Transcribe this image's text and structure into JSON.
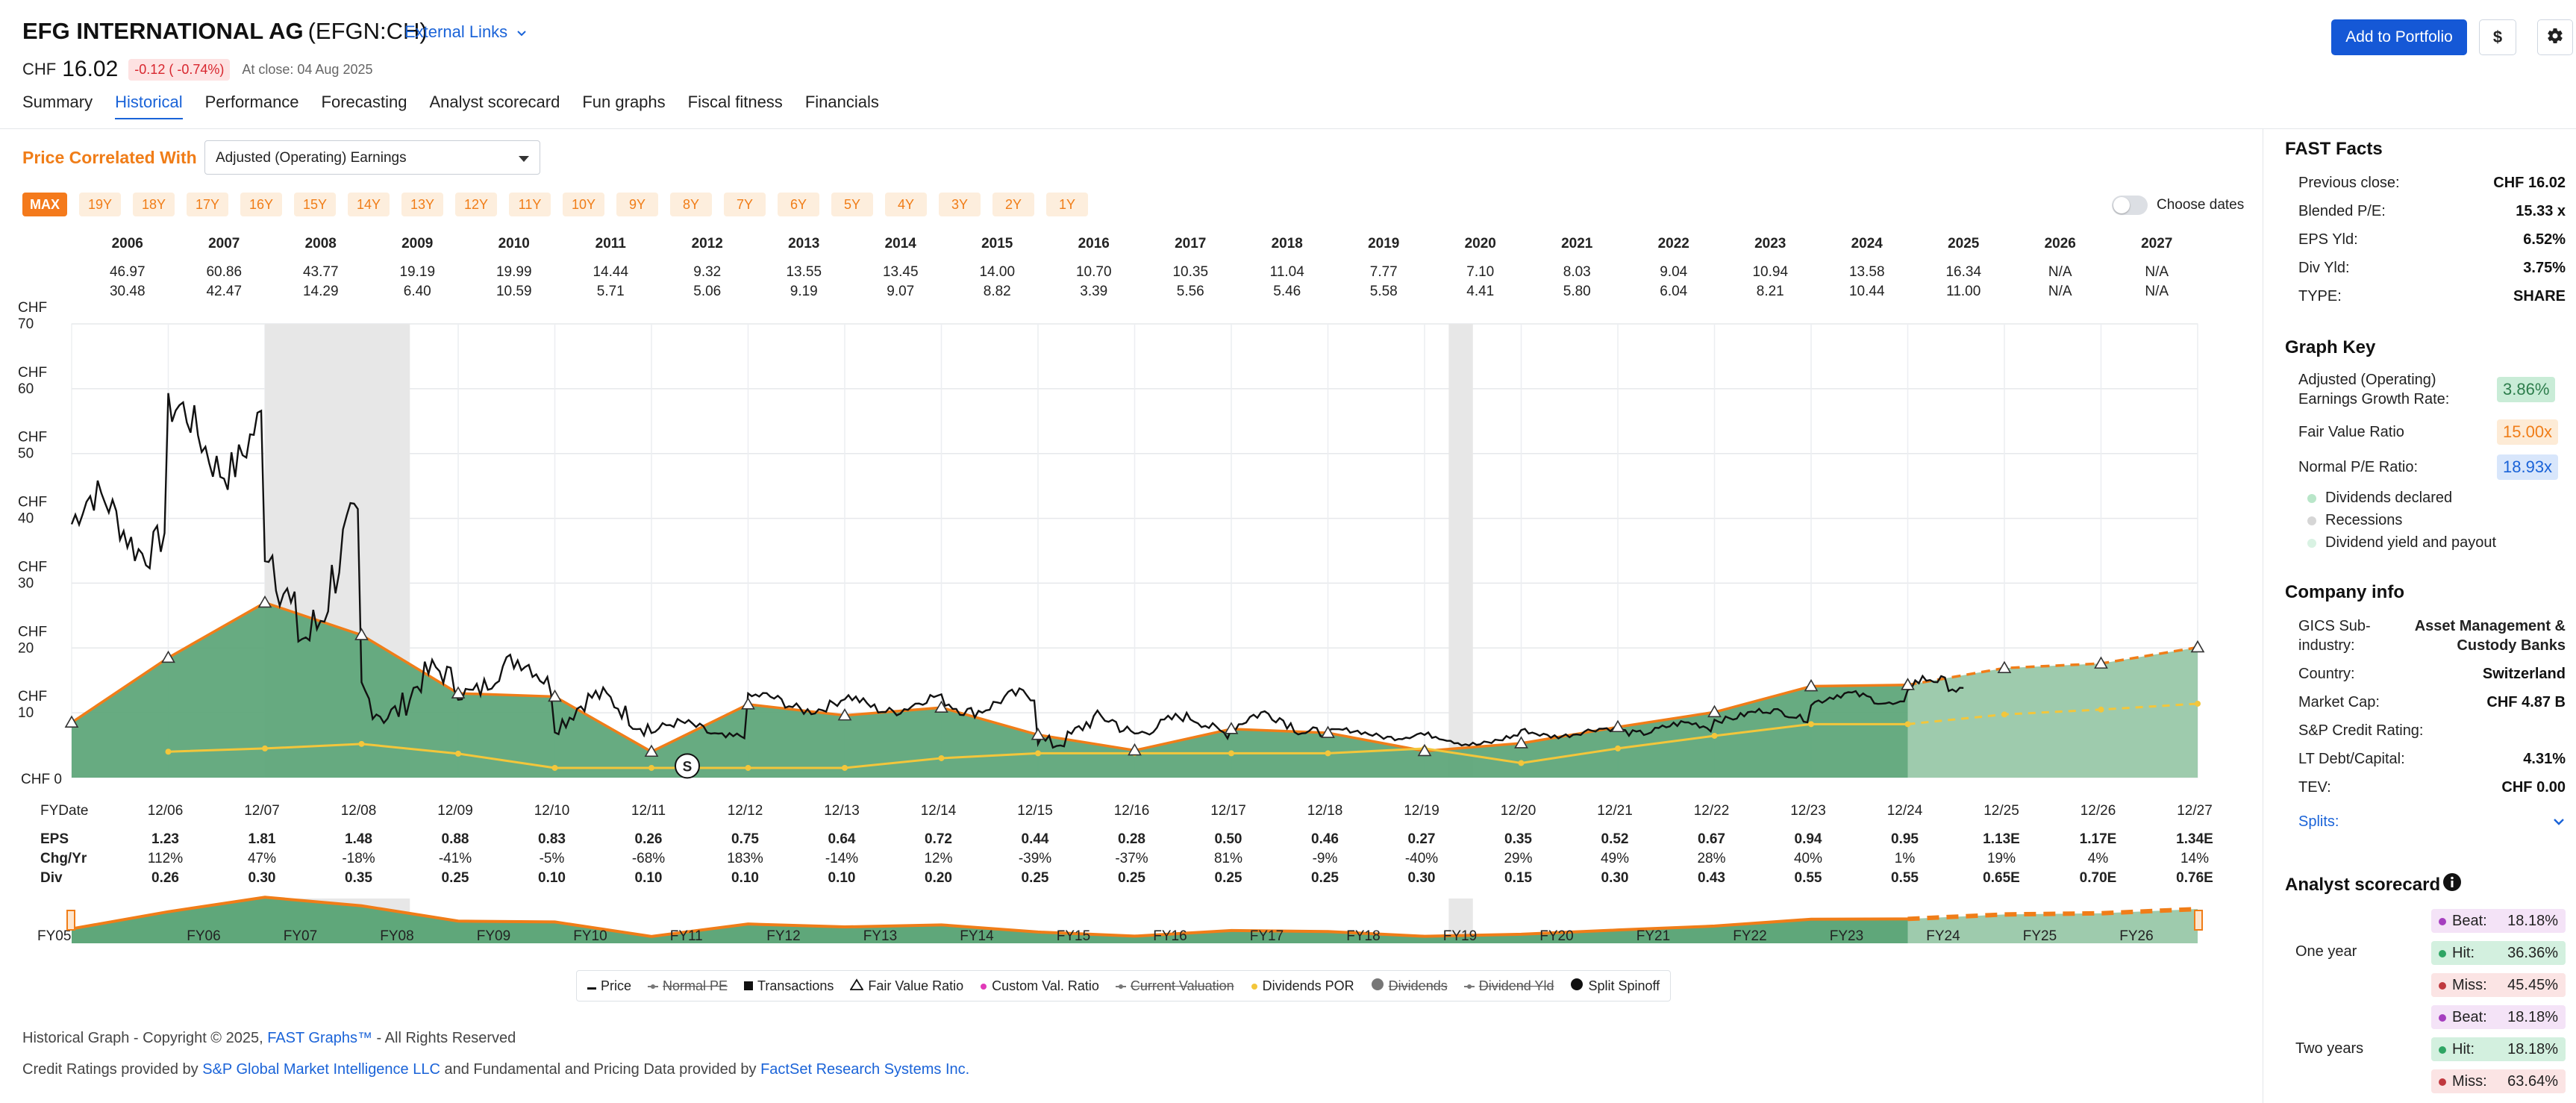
{
  "header": {
    "company": "EFG INTERNATIONAL AG",
    "ticker": "(EFGN:CH)",
    "external_links": "External Links",
    "currency": "CHF",
    "price": "16.02",
    "change": "-0.12 ( -0.74%)",
    "close_note": "At close: 04 Aug 2025",
    "add_portfolio": "Add to Portfolio",
    "currency_button": "$"
  },
  "nav": {
    "tabs": [
      "Summary",
      "Historical",
      "Performance",
      "Forecasting",
      "Analyst scorecard",
      "Fun graphs",
      "Fiscal fitness",
      "Financials"
    ],
    "active": "Historical"
  },
  "correlated": {
    "label": "Price Correlated With",
    "selected": "Adjusted (Operating) Earnings"
  },
  "ranges": [
    "MAX",
    "19Y",
    "18Y",
    "17Y",
    "16Y",
    "15Y",
    "14Y",
    "13Y",
    "12Y",
    "11Y",
    "10Y",
    "9Y",
    "8Y",
    "7Y",
    "6Y",
    "5Y",
    "4Y",
    "3Y",
    "2Y",
    "1Y"
  ],
  "choose_dates": "Choose dates",
  "yearly": {
    "years": [
      "2006",
      "2007",
      "2008",
      "2009",
      "2010",
      "2011",
      "2012",
      "2013",
      "2014",
      "2015",
      "2016",
      "2017",
      "2018",
      "2019",
      "2020",
      "2021",
      "2022",
      "2023",
      "2024",
      "2025",
      "2026",
      "2027"
    ],
    "highs": [
      "46.97",
      "60.86",
      "43.77",
      "19.19",
      "19.99",
      "14.44",
      "9.32",
      "13.55",
      "13.45",
      "14.00",
      "10.70",
      "10.35",
      "11.04",
      "7.77",
      "7.10",
      "8.03",
      "9.04",
      "10.94",
      "13.58",
      "16.34",
      "N/A",
      "N/A"
    ],
    "lows": [
      "30.48",
      "42.47",
      "14.29",
      "6.40",
      "10.59",
      "5.71",
      "5.06",
      "9.19",
      "9.07",
      "8.82",
      "3.39",
      "5.56",
      "5.46",
      "5.58",
      "4.41",
      "5.80",
      "6.04",
      "8.21",
      "10.44",
      "11.00",
      "N/A",
      "N/A"
    ]
  },
  "y_axis": [
    "CHF 70",
    "CHF 60",
    "CHF 50",
    "CHF 40",
    "CHF 30",
    "CHF 20",
    "CHF 10",
    "CHF 0"
  ],
  "fiscal": {
    "label_fydate": "FYDate",
    "label_eps": "EPS",
    "label_chg": "Chg/Yr",
    "label_div": "Div",
    "dates": [
      "12/06",
      "12/07",
      "12/08",
      "12/09",
      "12/10",
      "12/11",
      "12/12",
      "12/13",
      "12/14",
      "12/15",
      "12/16",
      "12/17",
      "12/18",
      "12/19",
      "12/20",
      "12/21",
      "12/22",
      "12/23",
      "12/24",
      "12/25",
      "12/26",
      "12/27"
    ],
    "eps": [
      "1.23",
      "1.81",
      "1.48",
      "0.88",
      "0.83",
      "0.26",
      "0.75",
      "0.64",
      "0.72",
      "0.44",
      "0.28",
      "0.50",
      "0.46",
      "0.27",
      "0.35",
      "0.52",
      "0.67",
      "0.94",
      "0.95",
      "1.13E",
      "1.17E",
      "1.34E"
    ],
    "chg": [
      "112%",
      "47%",
      "-18%",
      "-41%",
      "-5%",
      "-68%",
      "183%",
      "-14%",
      "12%",
      "-39%",
      "-37%",
      "81%",
      "-9%",
      "-40%",
      "29%",
      "49%",
      "28%",
      "40%",
      "1%",
      "19%",
      "4%",
      "14%"
    ],
    "div": [
      "0.26",
      "0.30",
      "0.35",
      "0.25",
      "0.10",
      "0.10",
      "0.10",
      "0.10",
      "0.20",
      "0.25",
      "0.25",
      "0.25",
      "0.25",
      "0.30",
      "0.15",
      "0.30",
      "0.43",
      "0.55",
      "0.55",
      "0.65E",
      "0.70E",
      "0.76E"
    ]
  },
  "mini_labels": [
    "FY05",
    "FY06",
    "FY07",
    "FY08",
    "FY09",
    "FY10",
    "FY11",
    "FY12",
    "FY13",
    "FY14",
    "FY15",
    "FY16",
    "FY17",
    "FY18",
    "FY19",
    "FY20",
    "FY21",
    "FY22",
    "FY23",
    "FY24",
    "FY25",
    "FY26"
  ],
  "split_marker": "S",
  "chart_data": {
    "type": "line",
    "ylabel": "CHF",
    "ylim": [
      0,
      70
    ],
    "x_dates": [
      "12/05",
      "12/06",
      "12/07",
      "12/08",
      "12/09",
      "12/10",
      "12/11",
      "12/12",
      "12/13",
      "12/14",
      "12/15",
      "12/16",
      "12/17",
      "12/18",
      "12/19",
      "12/20",
      "12/21",
      "12/22",
      "12/23",
      "12/24",
      "12/25",
      "12/26",
      "12/27"
    ],
    "fair_value": [
      8.5,
      18.5,
      27.0,
      22.0,
      13.0,
      12.5,
      4.0,
      11.3,
      9.6,
      10.8,
      6.6,
      4.2,
      7.5,
      6.9,
      4.1,
      5.3,
      7.8,
      10.1,
      14.1,
      14.3,
      16.9,
      17.6,
      20.1
    ],
    "dividend_por": [
      null,
      4.0,
      4.5,
      5.2,
      3.7,
      1.5,
      1.5,
      1.5,
      1.5,
      3.0,
      3.75,
      3.75,
      3.75,
      3.75,
      4.5,
      2.25,
      4.5,
      6.45,
      8.25,
      8.25,
      9.75,
      10.5,
      11.4
    ],
    "price_series_name": "Price",
    "recessions": [
      [
        "12/07",
        "06/09"
      ],
      [
        "03/20",
        "06/20"
      ]
    ],
    "estimate_start": "12/24",
    "split_date": "12/11"
  },
  "legend": [
    {
      "label": "Price",
      "strike": false
    },
    {
      "label": "Normal PE",
      "strike": true
    },
    {
      "label": "Transactions",
      "strike": false
    },
    {
      "label": "Fair Value Ratio",
      "strike": false
    },
    {
      "label": "Custom Val. Ratio",
      "strike": false
    },
    {
      "label": "Current Valuation",
      "strike": true
    },
    {
      "label": "Dividends POR",
      "strike": false
    },
    {
      "label": "Dividends",
      "strike": true
    },
    {
      "label": "Dividend Yld",
      "strike": true
    },
    {
      "label": "Split Spinoff",
      "strike": false
    }
  ],
  "footer": {
    "copyright_pre": "Historical Graph - Copyright © 2025, ",
    "copyright_link": "FAST Graphs™",
    "copyright_post": " - All Rights Reserved",
    "credits_pre": "Credit Ratings provided by ",
    "credits_link1": "S&P Global Market Intelligence LLC",
    "credits_mid": " and Fundamental and Pricing Data provided by ",
    "credits_link2": "FactSet Research Systems Inc."
  },
  "sidebar": {
    "fast_facts_title": "FAST Facts",
    "facts": [
      {
        "label": "Previous close:",
        "value": "CHF 16.02"
      },
      {
        "label": "Blended P/E:",
        "value": "15.33 x"
      },
      {
        "label": "EPS Yld:",
        "value": "6.52%"
      },
      {
        "label": "Div Yld:",
        "value": "3.75%"
      },
      {
        "label": "TYPE:",
        "value": "SHARE"
      }
    ],
    "graph_key_title": "Graph Key",
    "gk_growth_label1": "Adjusted (Operating)",
    "gk_growth_label2": "Earnings Growth Rate:",
    "gk_growth_value": "3.86%",
    "gk_fv_label": "Fair Value Ratio",
    "gk_fv_value": "15.00x",
    "gk_npe_label": "Normal P/E Ratio:",
    "gk_npe_value": "18.93x",
    "key_items": [
      "Dividends declared",
      "Recessions",
      "Dividend yield and payout"
    ],
    "company_info_title": "Company info",
    "gics_label1": "GICS Sub-",
    "gics_label2": "industry:",
    "gics_value1": "Asset Management &",
    "gics_value2": "Custody Banks",
    "info": [
      {
        "label": "Country:",
        "value": "Switzerland"
      },
      {
        "label": "Market Cap:",
        "value": "CHF 4.87 B"
      },
      {
        "label": "S&P Credit Rating:",
        "value": ""
      },
      {
        "label": "LT Debt/Capital:",
        "value": "4.31%"
      },
      {
        "label": "TEV:",
        "value": "CHF 0.00"
      }
    ],
    "splits_label": "Splits:",
    "scorecard_title": "Analyst scorecard",
    "one_year_label": "One year",
    "two_years_label": "Two years",
    "one_year": {
      "beat": "18.18%",
      "hit": "36.36%",
      "miss": "45.45%"
    },
    "two_years": {
      "beat": "18.18%",
      "hit": "18.18%",
      "miss": "63.64%"
    },
    "beat_label": "Beat:",
    "hit_label": "Hit:",
    "miss_label": "Miss:",
    "colors": {
      "green": "#5aa777",
      "orange": "#f07d18",
      "blue": "#1a63d8"
    }
  }
}
